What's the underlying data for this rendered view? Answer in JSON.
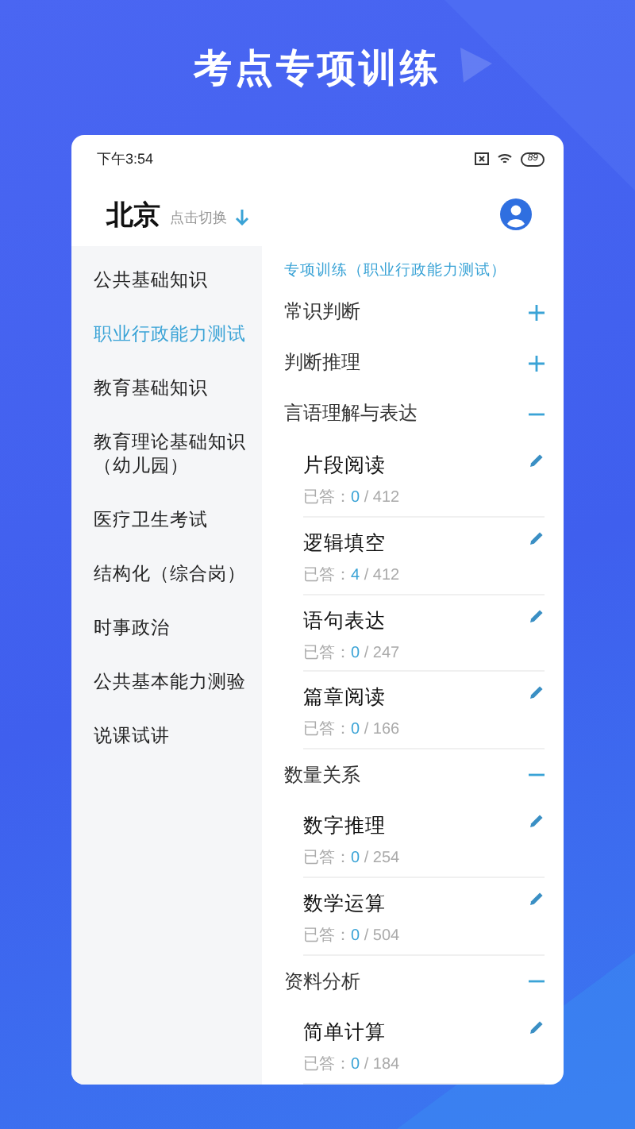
{
  "page_title": "考点专项训练",
  "status_bar": {
    "time": "下午3:54",
    "battery": "89"
  },
  "header": {
    "city": "北京",
    "switch_hint": "点击切换"
  },
  "sidebar": {
    "items": [
      {
        "label": "公共基础知识",
        "selected": false
      },
      {
        "label": "职业行政能力测试",
        "selected": true
      },
      {
        "label": "教育基础知识",
        "selected": false
      },
      {
        "label": "教育理论基础知识（幼儿园）",
        "selected": false
      },
      {
        "label": "医疗卫生考试",
        "selected": false
      },
      {
        "label": "结构化（综合岗）",
        "selected": false
      },
      {
        "label": "时事政治",
        "selected": false
      },
      {
        "label": "公共基本能力测验",
        "selected": false
      },
      {
        "label": "说课试讲",
        "selected": false
      }
    ]
  },
  "content": {
    "subtitle": "专项训练（职业行政能力测试）",
    "sections": [
      {
        "title": "常识判断",
        "expanded": false
      },
      {
        "title": "判断推理",
        "expanded": false
      },
      {
        "title": "言语理解与表达",
        "expanded": true,
        "children": [
          {
            "name": "片段阅读",
            "label": "已答：",
            "answered": "0",
            "total": "/ 412"
          },
          {
            "name": "逻辑填空",
            "label": "已答：",
            "answered": "4",
            "total": "/ 412"
          },
          {
            "name": "语句表达",
            "label": "已答：",
            "answered": "0",
            "total": "/ 247"
          },
          {
            "name": "篇章阅读",
            "label": "已答：",
            "answered": "0",
            "total": "/ 166"
          }
        ]
      },
      {
        "title": "数量关系",
        "expanded": true,
        "children": [
          {
            "name": "数字推理",
            "label": "已答：",
            "answered": "0",
            "total": "/ 254"
          },
          {
            "name": "数学运算",
            "label": "已答：",
            "answered": "0",
            "total": "/ 504"
          }
        ]
      },
      {
        "title": "资料分析",
        "expanded": true,
        "children": [
          {
            "name": "简单计算",
            "label": "已答：",
            "answered": "0",
            "total": "/ 184"
          }
        ]
      }
    ]
  }
}
